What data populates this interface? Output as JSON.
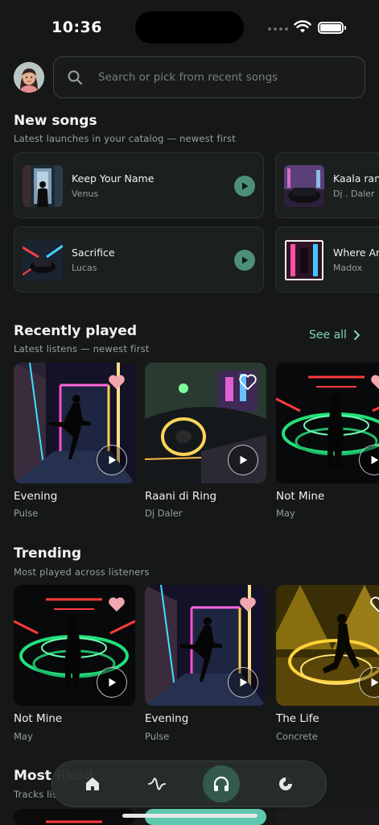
{
  "status_bar": {
    "time": "10:36"
  },
  "search": {
    "placeholder": "Search or pick from recent songs"
  },
  "new_songs": {
    "title": "New songs",
    "subtitle": "Latest launches in your catalog — newest first",
    "items": [
      {
        "title": "Keep Your Name",
        "artist": "Venus"
      },
      {
        "title": "Kaala ranga",
        "artist": "Dj . Daler"
      },
      {
        "title": "Sacrifice",
        "artist": "Lucas"
      },
      {
        "title": "Where Am I",
        "artist": "Madox"
      }
    ]
  },
  "recently_played": {
    "title": "Recently played",
    "subtitle": "Latest listens — newest first",
    "see_all": "See all",
    "items": [
      {
        "title": "Evening",
        "artist": "Pulse"
      },
      {
        "title": "Raani di Ring",
        "artist": "Dj  Daler"
      },
      {
        "title": "Not Mine",
        "artist": "May"
      }
    ]
  },
  "trending": {
    "title": "Trending",
    "subtitle": "Most played across listeners",
    "items": [
      {
        "title": "Not Mine",
        "artist": "May"
      },
      {
        "title": "Evening",
        "artist": "Pulse"
      },
      {
        "title": "The Life",
        "artist": "Concrete"
      }
    ]
  },
  "most_liked": {
    "title": "Most liked",
    "subtitle": "Tracks listeners like most"
  },
  "nav": {
    "items": [
      "home-icon",
      "pulse-icon",
      "headphones-icon",
      "stats-icon"
    ],
    "active": "headphones-icon"
  },
  "colors": {
    "accent": "#7fd3c4",
    "play_green": "#4e8f7c",
    "heart": "#f2a6ad",
    "background": "#151816"
  }
}
